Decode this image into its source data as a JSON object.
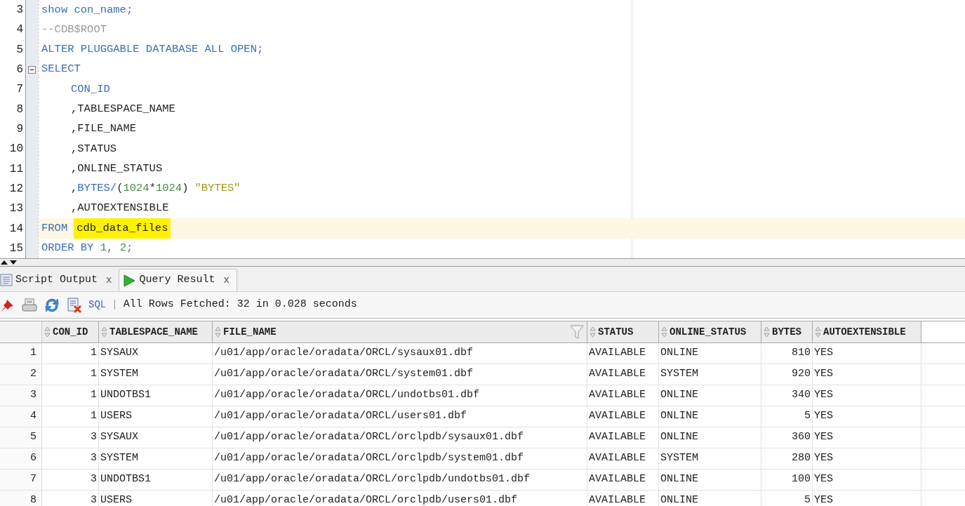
{
  "editor": {
    "lines": [
      {
        "number": "3",
        "tokens": [
          {
            "text": "show con_name;",
            "kind": "keyword"
          }
        ]
      },
      {
        "number": "4",
        "tokens": [
          {
            "text": "--CDB$ROOT",
            "kind": "comment"
          }
        ]
      },
      {
        "number": "5",
        "tokens": [
          {
            "text": "ALTER PLUGGABLE DATABASE ALL OPEN;",
            "kind": "keyword"
          }
        ]
      },
      {
        "number": "6",
        "expanded": true,
        "tokens": [
          {
            "text": "SELECT",
            "kind": "keyword"
          }
        ],
        "children": [
          {
            "number": "7",
            "tokens": [
              {
                "text": "CON_ID",
                "kind": "keyword"
              }
            ]
          },
          {
            "number": "8",
            "tokens": [
              {
                "text": ",TABLESPACE_NAME",
                "kind": "plain"
              }
            ]
          },
          {
            "number": "9",
            "tokens": [
              {
                "text": ",FILE_NAME",
                "kind": "plain"
              }
            ]
          },
          {
            "number": "10",
            "tokens": [
              {
                "text": ",STATUS",
                "kind": "plain"
              }
            ]
          },
          {
            "number": "11",
            "tokens": [
              {
                "text": ",ONLINE_STATUS",
                "kind": "plain"
              }
            ]
          },
          {
            "number": "12",
            "tokens": [
              {
                "text": ",",
                "kind": "plain"
              },
              {
                "text": "BYTES/",
                "kind": "keyword"
              },
              {
                "text": "(",
                "kind": "plain"
              },
              {
                "text": "1024",
                "kind": "number"
              },
              {
                "text": "*",
                "kind": "plain"
              },
              {
                "text": "1024",
                "kind": "number"
              },
              {
                "text": ")",
                "kind": "plain"
              },
              {
                "text": "\"BYTES\"",
                "kind": "string",
                "space_before": true
              }
            ]
          },
          {
            "number": "13",
            "tokens": [
              {
                "text": ",AUTOEXTENSIBLE",
                "kind": "plain"
              }
            ]
          }
        ]
      },
      {
        "number": "14",
        "current": true,
        "tokens": [
          {
            "text": "FROM",
            "kind": "keyword"
          },
          {
            "text": "cdb_data_files",
            "kind": "plain",
            "highlighted": true,
            "space_before": true
          }
        ]
      },
      {
        "number": "15",
        "tokens": [
          {
            "text": "ORDER BY ",
            "kind": "keyword"
          },
          {
            "text": "1",
            "kind": "number"
          },
          {
            "text": ", ",
            "kind": "keyword"
          },
          {
            "text": "2",
            "kind": "number"
          },
          {
            "text": ";",
            "kind": "keyword"
          }
        ]
      }
    ]
  },
  "tabs": [
    {
      "label": "Script Output",
      "kind": "script",
      "selected": false,
      "close": "x"
    },
    {
      "label": "Query Result",
      "kind": "query",
      "selected": true,
      "close": "x"
    }
  ],
  "toolbar": {
    "link": "SQL",
    "separator": "|",
    "status": "All Rows Fetched: 32 in 0.028 seconds"
  },
  "table": {
    "columns": [
      {
        "label": "CON_ID",
        "kind": "number",
        "filter": false
      },
      {
        "label": "TABLESPACE_NAME",
        "kind": "text",
        "filter": false
      },
      {
        "label": "FILE_NAME",
        "kind": "text",
        "filter": true
      },
      {
        "label": "STATUS",
        "kind": "text",
        "filter": false
      },
      {
        "label": "ONLINE_STATUS",
        "kind": "text",
        "filter": false
      },
      {
        "label": "BYTES",
        "kind": "number",
        "filter": false
      },
      {
        "label": "AUTOEXTENSIBLE",
        "kind": "text",
        "filter": false
      }
    ],
    "rows": [
      {
        "number": "1",
        "cells": [
          "1",
          "SYSAUX",
          "/u01/app/oracle/oradata/ORCL/sysaux01.dbf",
          "AVAILABLE",
          "ONLINE",
          "810",
          "YES"
        ]
      },
      {
        "number": "2",
        "cells": [
          "1",
          "SYSTEM",
          "/u01/app/oracle/oradata/ORCL/system01.dbf",
          "AVAILABLE",
          "SYSTEM",
          "920",
          "YES"
        ]
      },
      {
        "number": "3",
        "cells": [
          "1",
          "UNDOTBS1",
          "/u01/app/oracle/oradata/ORCL/undotbs01.dbf",
          "AVAILABLE",
          "ONLINE",
          "340",
          "YES"
        ]
      },
      {
        "number": "4",
        "cells": [
          "1",
          "USERS",
          "/u01/app/oracle/oradata/ORCL/users01.dbf",
          "AVAILABLE",
          "ONLINE",
          "5",
          "YES"
        ]
      },
      {
        "number": "5",
        "cells": [
          "3",
          "SYSAUX",
          "/u01/app/oracle/oradata/ORCL/orclpdb/sysaux01.dbf",
          "AVAILABLE",
          "ONLINE",
          "360",
          "YES"
        ]
      },
      {
        "number": "6",
        "cells": [
          "3",
          "SYSTEM",
          "/u01/app/oracle/oradata/ORCL/orclpdb/system01.dbf",
          "AVAILABLE",
          "SYSTEM",
          "280",
          "YES"
        ]
      },
      {
        "number": "7",
        "cells": [
          "3",
          "UNDOTBS1",
          "/u01/app/oracle/oradata/ORCL/orclpdb/undotbs01.dbf",
          "AVAILABLE",
          "ONLINE",
          "100",
          "YES"
        ]
      },
      {
        "number": "8",
        "cells": [
          "3",
          "USERS",
          "/u01/app/oracle/oradata/ORCL/orclpdb/users01.dbf",
          "AVAILABLE",
          "ONLINE",
          "5",
          "YES"
        ]
      }
    ]
  }
}
